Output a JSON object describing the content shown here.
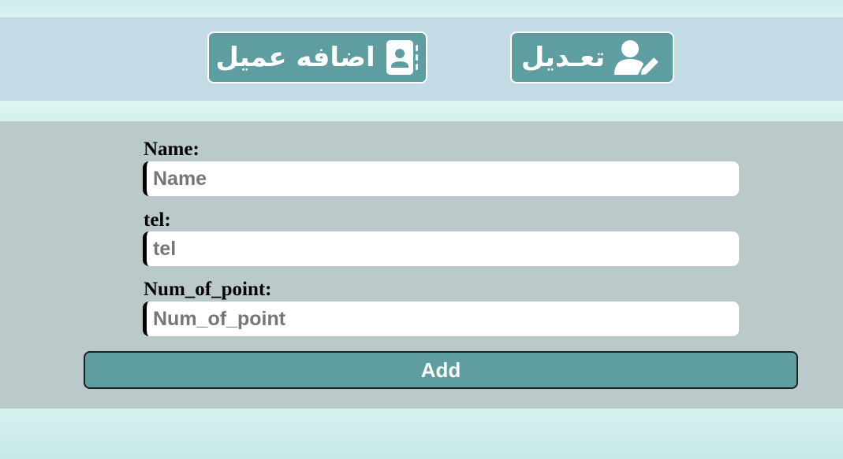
{
  "header": {
    "add_customer": {
      "label": "اضافه عميل",
      "icon": "address-book-icon"
    },
    "edit": {
      "label": "تعـديل",
      "icon": "user-edit-icon"
    }
  },
  "form": {
    "fields": [
      {
        "label": "Name:",
        "placeholder": "Name",
        "value": ""
      },
      {
        "label": "tel:",
        "placeholder": "tel",
        "value": ""
      },
      {
        "label": "Num_of_point:",
        "placeholder": "Num_of_point",
        "value": ""
      }
    ],
    "submit_label": "Add"
  },
  "colors": {
    "button": "#5f9ea0",
    "header_band": "#c2dbe4",
    "form_panel": "#bac9ca"
  }
}
